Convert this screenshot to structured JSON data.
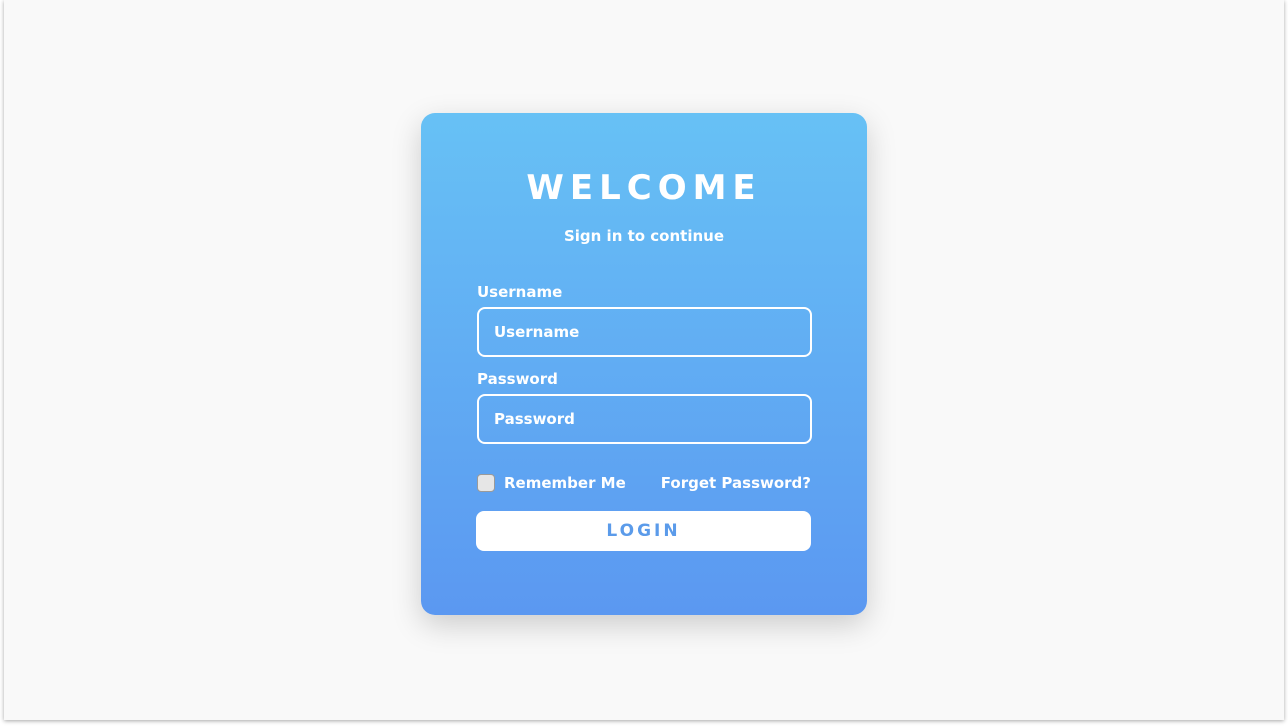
{
  "login_card": {
    "title": "WELCOME",
    "subtitle": "Sign in to continue",
    "username": {
      "label": "Username",
      "placeholder": "Username",
      "value": ""
    },
    "password": {
      "label": "Password",
      "placeholder": "Password",
      "value": ""
    },
    "remember_me": {
      "label": "Remember Me",
      "checked": false
    },
    "forgot_password_label": "Forget Password?",
    "login_button_label": "LOGIN"
  },
  "colors": {
    "page_background": "#f9f9f9",
    "card_gradient_top": "#67c1f5",
    "card_gradient_bottom": "#5b98f1",
    "button_text": "#5b9bea",
    "text_white": "#ffffff"
  }
}
